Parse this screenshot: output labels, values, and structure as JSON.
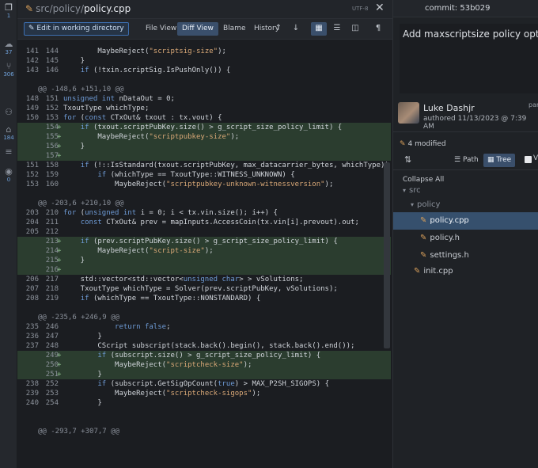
{
  "activity_bar": [
    {
      "icon": "document-icon",
      "glyph": "❐",
      "count": "1"
    },
    {
      "icon": "cloud-icon",
      "glyph": "☁",
      "count": "37"
    },
    {
      "icon": "branch-icon",
      "glyph": "⑂",
      "count": "306"
    },
    {
      "icon": "users-icon",
      "glyph": "⚇",
      "count": ""
    },
    {
      "icon": "tag-icon",
      "glyph": "⌂",
      "count": "184"
    },
    {
      "icon": "stack-icon",
      "glyph": "≡",
      "count": ""
    },
    {
      "icon": "submodule-icon",
      "glyph": "◉",
      "count": "0"
    }
  ],
  "title": {
    "path_prefix": "src/policy/",
    "file": "policy.cpp",
    "encoding": "UTF-8",
    "close": "✕"
  },
  "toolbar": {
    "edit": "Edit in working directory",
    "file_view": "File View",
    "diff_view": "Diff View",
    "blame": "Blame",
    "history": "History",
    "up": "↑",
    "down": "↓",
    "icon_unified": "▦",
    "icon_list": "☰",
    "icon_split": "◫",
    "icon_pilcrow": "¶"
  },
  "diff": [
    {
      "type": "ctx",
      "old": "141",
      "new": "144",
      "sign": "",
      "code": "        MaybeReject(\"scriptsig-size\");"
    },
    {
      "type": "ctx",
      "old": "142",
      "new": "145",
      "sign": "",
      "code": "    }"
    },
    {
      "type": "ctx",
      "old": "143",
      "new": "146",
      "sign": "",
      "code": "    if (!txin.scriptSig.IsPushOnly()) {"
    },
    {
      "type": "gap"
    },
    {
      "type": "hunk",
      "code": "@@ -148,6 +151,10 @@"
    },
    {
      "type": "ctx",
      "old": "148",
      "new": "151",
      "sign": "",
      "code": "unsigned int nDataOut = 0;"
    },
    {
      "type": "ctx",
      "old": "149",
      "new": "152",
      "sign": "",
      "code": "TxoutType whichType;"
    },
    {
      "type": "ctx",
      "old": "150",
      "new": "153",
      "sign": "",
      "code": "for (const CTxOut& txout : tx.vout) {"
    },
    {
      "type": "add",
      "old": "",
      "new": "154",
      "sign": "+",
      "code": "    if (txout.scriptPubKey.size() > g_script_size_policy_limit) {"
    },
    {
      "type": "add",
      "old": "",
      "new": "155",
      "sign": "+",
      "code": "        MaybeReject(\"scriptpubkey-size\");"
    },
    {
      "type": "add",
      "old": "",
      "new": "156",
      "sign": "+",
      "code": "    }"
    },
    {
      "type": "add",
      "old": "",
      "new": "157",
      "sign": "+",
      "code": ""
    },
    {
      "type": "ctx",
      "old": "151",
      "new": "158",
      "sign": "",
      "code": "    if (!::IsStandard(txout.scriptPubKey, max_datacarrier_bytes, whichType)) {"
    },
    {
      "type": "ctx",
      "old": "152",
      "new": "159",
      "sign": "",
      "code": "        if (whichType == TxoutType::WITNESS_UNKNOWN) {"
    },
    {
      "type": "ctx",
      "old": "153",
      "new": "160",
      "sign": "",
      "code": "            MaybeReject(\"scriptpubkey-unknown-witnessversion\");"
    },
    {
      "type": "gap"
    },
    {
      "type": "hunk",
      "code": "@@ -203,6 +210,10 @@"
    },
    {
      "type": "ctx",
      "old": "203",
      "new": "210",
      "sign": "",
      "code": "for (unsigned int i = 0; i < tx.vin.size(); i++) {"
    },
    {
      "type": "ctx",
      "old": "204",
      "new": "211",
      "sign": "",
      "code": "    const CTxOut& prev = mapInputs.AccessCoin(tx.vin[i].prevout).out;"
    },
    {
      "type": "ctx",
      "old": "205",
      "new": "212",
      "sign": "",
      "code": ""
    },
    {
      "type": "add",
      "old": "",
      "new": "213",
      "sign": "+",
      "code": "    if (prev.scriptPubKey.size() > g_script_size_policy_limit) {"
    },
    {
      "type": "add",
      "old": "",
      "new": "214",
      "sign": "+",
      "code": "        MaybeReject(\"script-size\");"
    },
    {
      "type": "add",
      "old": "",
      "new": "215",
      "sign": "+",
      "code": "    }"
    },
    {
      "type": "add",
      "old": "",
      "new": "216",
      "sign": "+",
      "code": ""
    },
    {
      "type": "ctx",
      "old": "206",
      "new": "217",
      "sign": "",
      "code": "    std::vector<std::vector<unsigned char> > vSolutions;"
    },
    {
      "type": "ctx",
      "old": "207",
      "new": "218",
      "sign": "",
      "code": "    TxoutType whichType = Solver(prev.scriptPubKey, vSolutions);"
    },
    {
      "type": "ctx",
      "old": "208",
      "new": "219",
      "sign": "",
      "code": "    if (whichType == TxoutType::NONSTANDARD) {"
    },
    {
      "type": "gap"
    },
    {
      "type": "hunk",
      "code": "@@ -235,6 +246,9 @@"
    },
    {
      "type": "ctx",
      "old": "235",
      "new": "246",
      "sign": "",
      "code": "            return false;"
    },
    {
      "type": "ctx",
      "old": "236",
      "new": "247",
      "sign": "",
      "code": "        }"
    },
    {
      "type": "ctx",
      "old": "237",
      "new": "248",
      "sign": "",
      "code": "        CScript subscript(stack.back().begin(), stack.back().end());"
    },
    {
      "type": "add",
      "old": "",
      "new": "249",
      "sign": "+",
      "code": "        if (subscript.size() > g_script_size_policy_limit) {"
    },
    {
      "type": "add",
      "old": "",
      "new": "250",
      "sign": "+",
      "code": "            MaybeReject(\"scriptcheck-size\");"
    },
    {
      "type": "add",
      "old": "",
      "new": "251",
      "sign": "+",
      "code": "        }"
    },
    {
      "type": "ctx",
      "old": "238",
      "new": "252",
      "sign": "",
      "code": "        if (subscript.GetSigOpCount(true) > MAX_P2SH_SIGOPS) {"
    },
    {
      "type": "ctx",
      "old": "239",
      "new": "253",
      "sign": "",
      "code": "            MaybeReject(\"scriptcheck-sigops\");"
    },
    {
      "type": "ctx",
      "old": "240",
      "new": "254",
      "sign": "",
      "code": "        }"
    },
    {
      "type": "gap"
    },
    {
      "type": "gap"
    },
    {
      "type": "hunk",
      "code": "@@ -293,7 +307,7 @@"
    }
  ],
  "commit": {
    "label": "commit:",
    "sha": "53b029",
    "message": "Add maxscriptsize policy option",
    "author": "Luke Dashjr",
    "date": "authored 11/13/2023 @ 7:39 AM",
    "extra": "par"
  },
  "files_panel": {
    "modified": "4 modified",
    "sort_icon": "⇅",
    "path": "Path",
    "tree": "Tree",
    "checkbox_label": "V",
    "collapse_all": "Collapse All",
    "tree_items": [
      {
        "label": "src",
        "kind": "folder",
        "depth": 0
      },
      {
        "label": "policy",
        "kind": "folder",
        "depth": 1
      },
      {
        "label": "policy.cpp",
        "kind": "file",
        "depth": 2,
        "selected": true
      },
      {
        "label": "policy.h",
        "kind": "file",
        "depth": 2,
        "selected": false
      },
      {
        "label": "settings.h",
        "kind": "file",
        "depth": 2,
        "selected": false
      },
      {
        "label": "init.cpp",
        "kind": "file",
        "depth": 1,
        "selected": false
      }
    ]
  },
  "colors": {
    "added_bg": "#2b3d2f",
    "selection": "#36506d",
    "accent": "#3d6fb0",
    "modified_pen": "#d9a05b"
  }
}
